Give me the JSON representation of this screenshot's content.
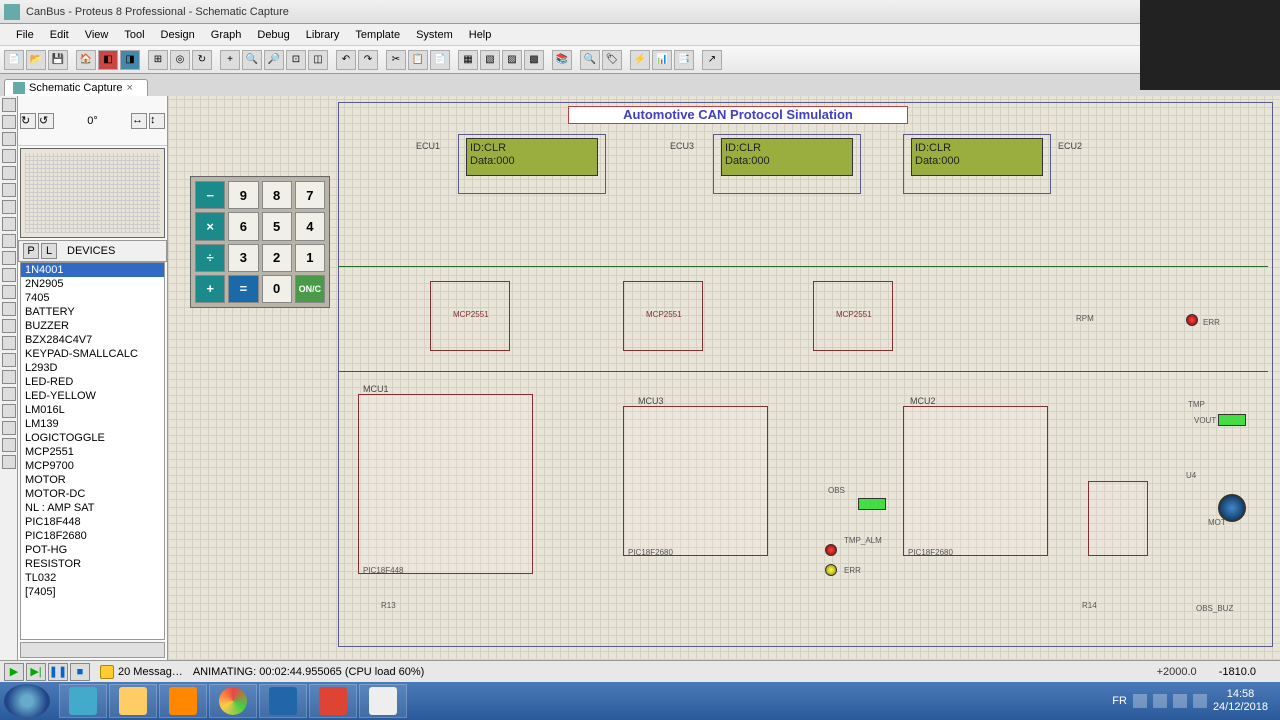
{
  "title": "CanBus - Proteus 8 Professional - Schematic Capture",
  "menus": [
    "File",
    "Edit",
    "View",
    "Tool",
    "Design",
    "Graph",
    "Debug",
    "Library",
    "Template",
    "System",
    "Help"
  ],
  "tab": {
    "label": "Schematic Capture"
  },
  "devices_header": "DEVICES",
  "devices": [
    "1N4001",
    "2N2905",
    "7405",
    "BATTERY",
    "BUZZER",
    "BZX284C4V7",
    "KEYPAD-SMALLCALC",
    "L293D",
    "LED-RED",
    "LED-YELLOW",
    "LM016L",
    "LM139",
    "LOGICTOGGLE",
    "MCP2551",
    "MCP9700",
    "MOTOR",
    "MOTOR-DC",
    "NL : AMP SAT",
    "PIC18F448",
    "PIC18F2680",
    "POT-HG",
    "RESISTOR",
    "TL032",
    "[7405]"
  ],
  "device_selected": 0,
  "rotation": "0°",
  "schematic": {
    "title": "Automotive CAN Protocol Simulation",
    "ecu_labels": [
      "ECU1",
      "ECU3",
      "ECU2"
    ],
    "lcd": {
      "line1": "ID:CLR",
      "line2": "Data:000"
    },
    "mcp_label": "MCP2551",
    "mcu_labels": [
      "MCU1",
      "MCU3",
      "MCU2"
    ],
    "mcu_part": "PIC18F2680",
    "mcu_part2": "PIC18F448",
    "keypad": [
      [
        "−",
        "9",
        "8",
        "7"
      ],
      [
        "×",
        "6",
        "5",
        "4"
      ],
      [
        "÷",
        "3",
        "2",
        "1"
      ],
      [
        "+",
        "=",
        "0",
        "ON/C"
      ]
    ],
    "labels": {
      "rpm": "RPM",
      "err": "ERR",
      "tmp": "TMP",
      "obs": "OBS",
      "tmp_alm": "TMP_ALM",
      "mot": "MOT",
      "obs_buz": "OBS_BUZ",
      "u4": "U4",
      "r13": "R13",
      "r14": "R14",
      "vout": "VOUT"
    }
  },
  "status": {
    "messages": "20 Messag…",
    "anim": "ANIMATING: 00:02:44.955065 (CPU load 60%)",
    "coord1": "+2000.0",
    "coord2": "-1810.0"
  },
  "tray": {
    "lang": "FR",
    "time": "14:58",
    "date": "24/12/2018"
  }
}
